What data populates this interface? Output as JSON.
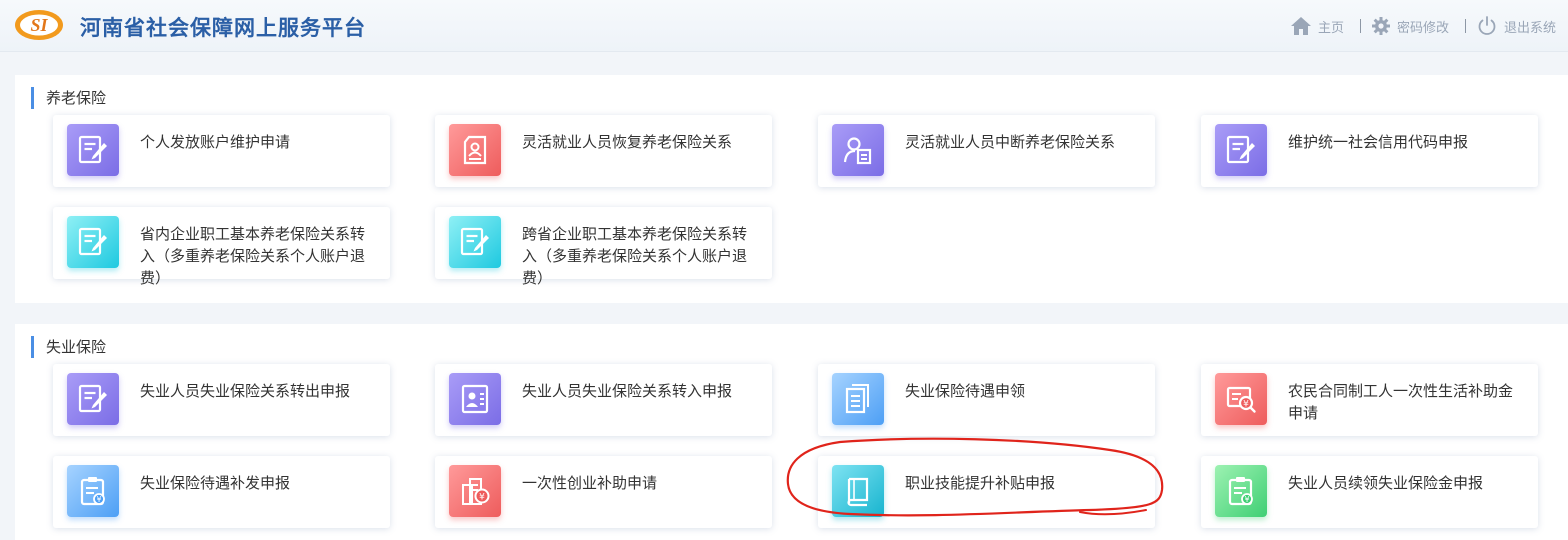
{
  "header": {
    "title": "河南省社会保障网上服务平台",
    "logo_text": "SI",
    "nav": {
      "home": "主页",
      "change_password": "密码修改",
      "logout": "退出系统"
    }
  },
  "sections": [
    {
      "title": "养老保险",
      "cards": [
        {
          "label": "个人发放账户维护申请",
          "icon": "form-pen-icon",
          "color": "#7b6de6"
        },
        {
          "label": "灵活就业人员恢复养老保险关系",
          "icon": "id-document-icon",
          "color": "#ee5c5c"
        },
        {
          "label": "灵活就业人员中断养老保险关系",
          "icon": "person-document-icon",
          "color": "#7b6de6"
        },
        {
          "label": "维护统一社会信用代码申报",
          "icon": "form-pen-icon",
          "color": "#7b6de6"
        },
        {
          "label": "省内企业职工基本养老保险关系转入（多重养老保险关系个人账户退费）",
          "icon": "form-pen-icon",
          "color": "#1ec9e0"
        },
        {
          "label": "跨省企业职工基本养老保险关系转入（多重养老保险关系个人账户退费）",
          "icon": "form-pen-icon",
          "color": "#1ec9e0"
        }
      ]
    },
    {
      "title": "失业保险",
      "cards": [
        {
          "label": "失业人员失业保险关系转出申报",
          "icon": "form-pen-icon",
          "color": "#7b6de6"
        },
        {
          "label": "失业人员失业保险关系转入申报",
          "icon": "person-card-icon",
          "color": "#7b6de6"
        },
        {
          "label": "失业保险待遇申领",
          "icon": "documents-icon",
          "color": "#4d9ff5"
        },
        {
          "label": "农民合同制工人一次性生活补助金申请",
          "icon": "money-search-icon",
          "color": "#ee5c5c"
        },
        {
          "label": "失业保险待遇补发申报",
          "icon": "clipboard-money-icon",
          "color": "#4d9ff5"
        },
        {
          "label": "一次性创业补助申请",
          "icon": "building-money-icon",
          "color": "#ee5c5c"
        },
        {
          "label": "职业技能提升补贴申报",
          "icon": "book-icon",
          "color": "#17b4cf"
        },
        {
          "label": "失业人员续领失业保险金申报",
          "icon": "clipboard-money-icon",
          "color": "#3fcf74"
        }
      ]
    }
  ],
  "annotation": {
    "color": "#e0241b",
    "shape": "hand-drawn-ellipse",
    "target_card": "职业技能提升补贴申报"
  }
}
